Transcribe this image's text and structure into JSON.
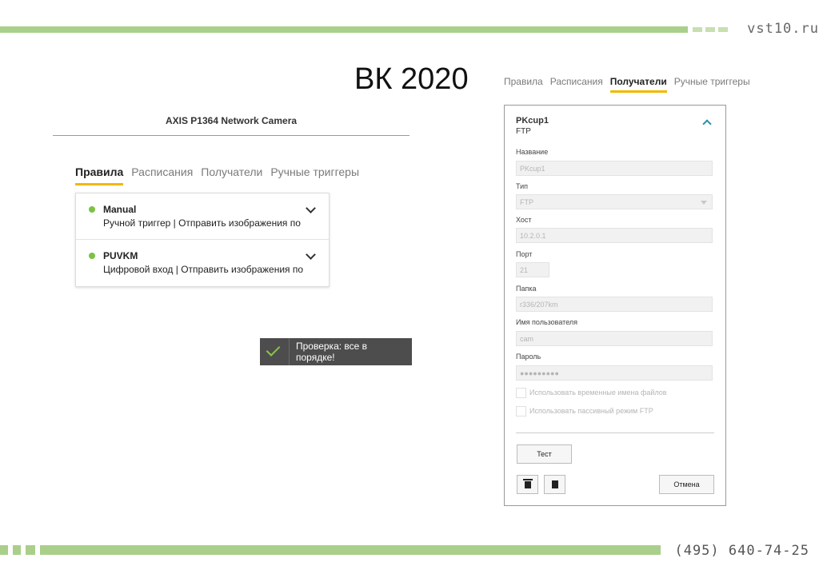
{
  "slide": {
    "site": "vst10.ru",
    "title": "ВК 2020",
    "phone": "(495) 640-74-25"
  },
  "camera": {
    "title": "AXIS P1364 Network Camera",
    "tabs": [
      "Правила",
      "Расписания",
      "Получатели",
      "Ручные триггеры"
    ],
    "active_tab": "Правила",
    "rules": [
      {
        "name": "Manual",
        "desc": "Ручной триггер | Отправить изображения по",
        "status_color": "#7cc243"
      },
      {
        "name": "PUVKM",
        "desc": "Цифровой вход | Отправить изображения по",
        "status_color": "#7cc243"
      }
    ]
  },
  "toast": {
    "text": "Проверка: все в порядке!",
    "icon": "checkmark-icon"
  },
  "recipients": {
    "tabs": [
      "Правила",
      "Расписания",
      "Получатели",
      "Ручные триггеры"
    ],
    "active_tab": "Получатели",
    "card": {
      "name": "PKcup1",
      "type": "FTP",
      "fields": {
        "name_label": "Название",
        "name_value": "PKcup1",
        "type_label": "Тип",
        "type_value": "FTP",
        "host_label": "Хост",
        "host_value": "10.2.0.1",
        "port_label": "Порт",
        "port_value": "21",
        "folder_label": "Папка",
        "folder_value": "r336/207km",
        "user_label": "Имя пользователя",
        "user_value": "cam",
        "password_label": "Пароль",
        "password_value": "●●●●●●●●●"
      },
      "checkbox_temp_names": "Использовать временные имена файлов",
      "checkbox_passive": "Использовать пассивный режим FTP",
      "test_button": "Тест",
      "cancel_button": "Отмена"
    }
  },
  "colors": {
    "accent_green": "#a9cf8a",
    "tab_underline": "#f2b800",
    "status_dot": "#7cc243"
  }
}
